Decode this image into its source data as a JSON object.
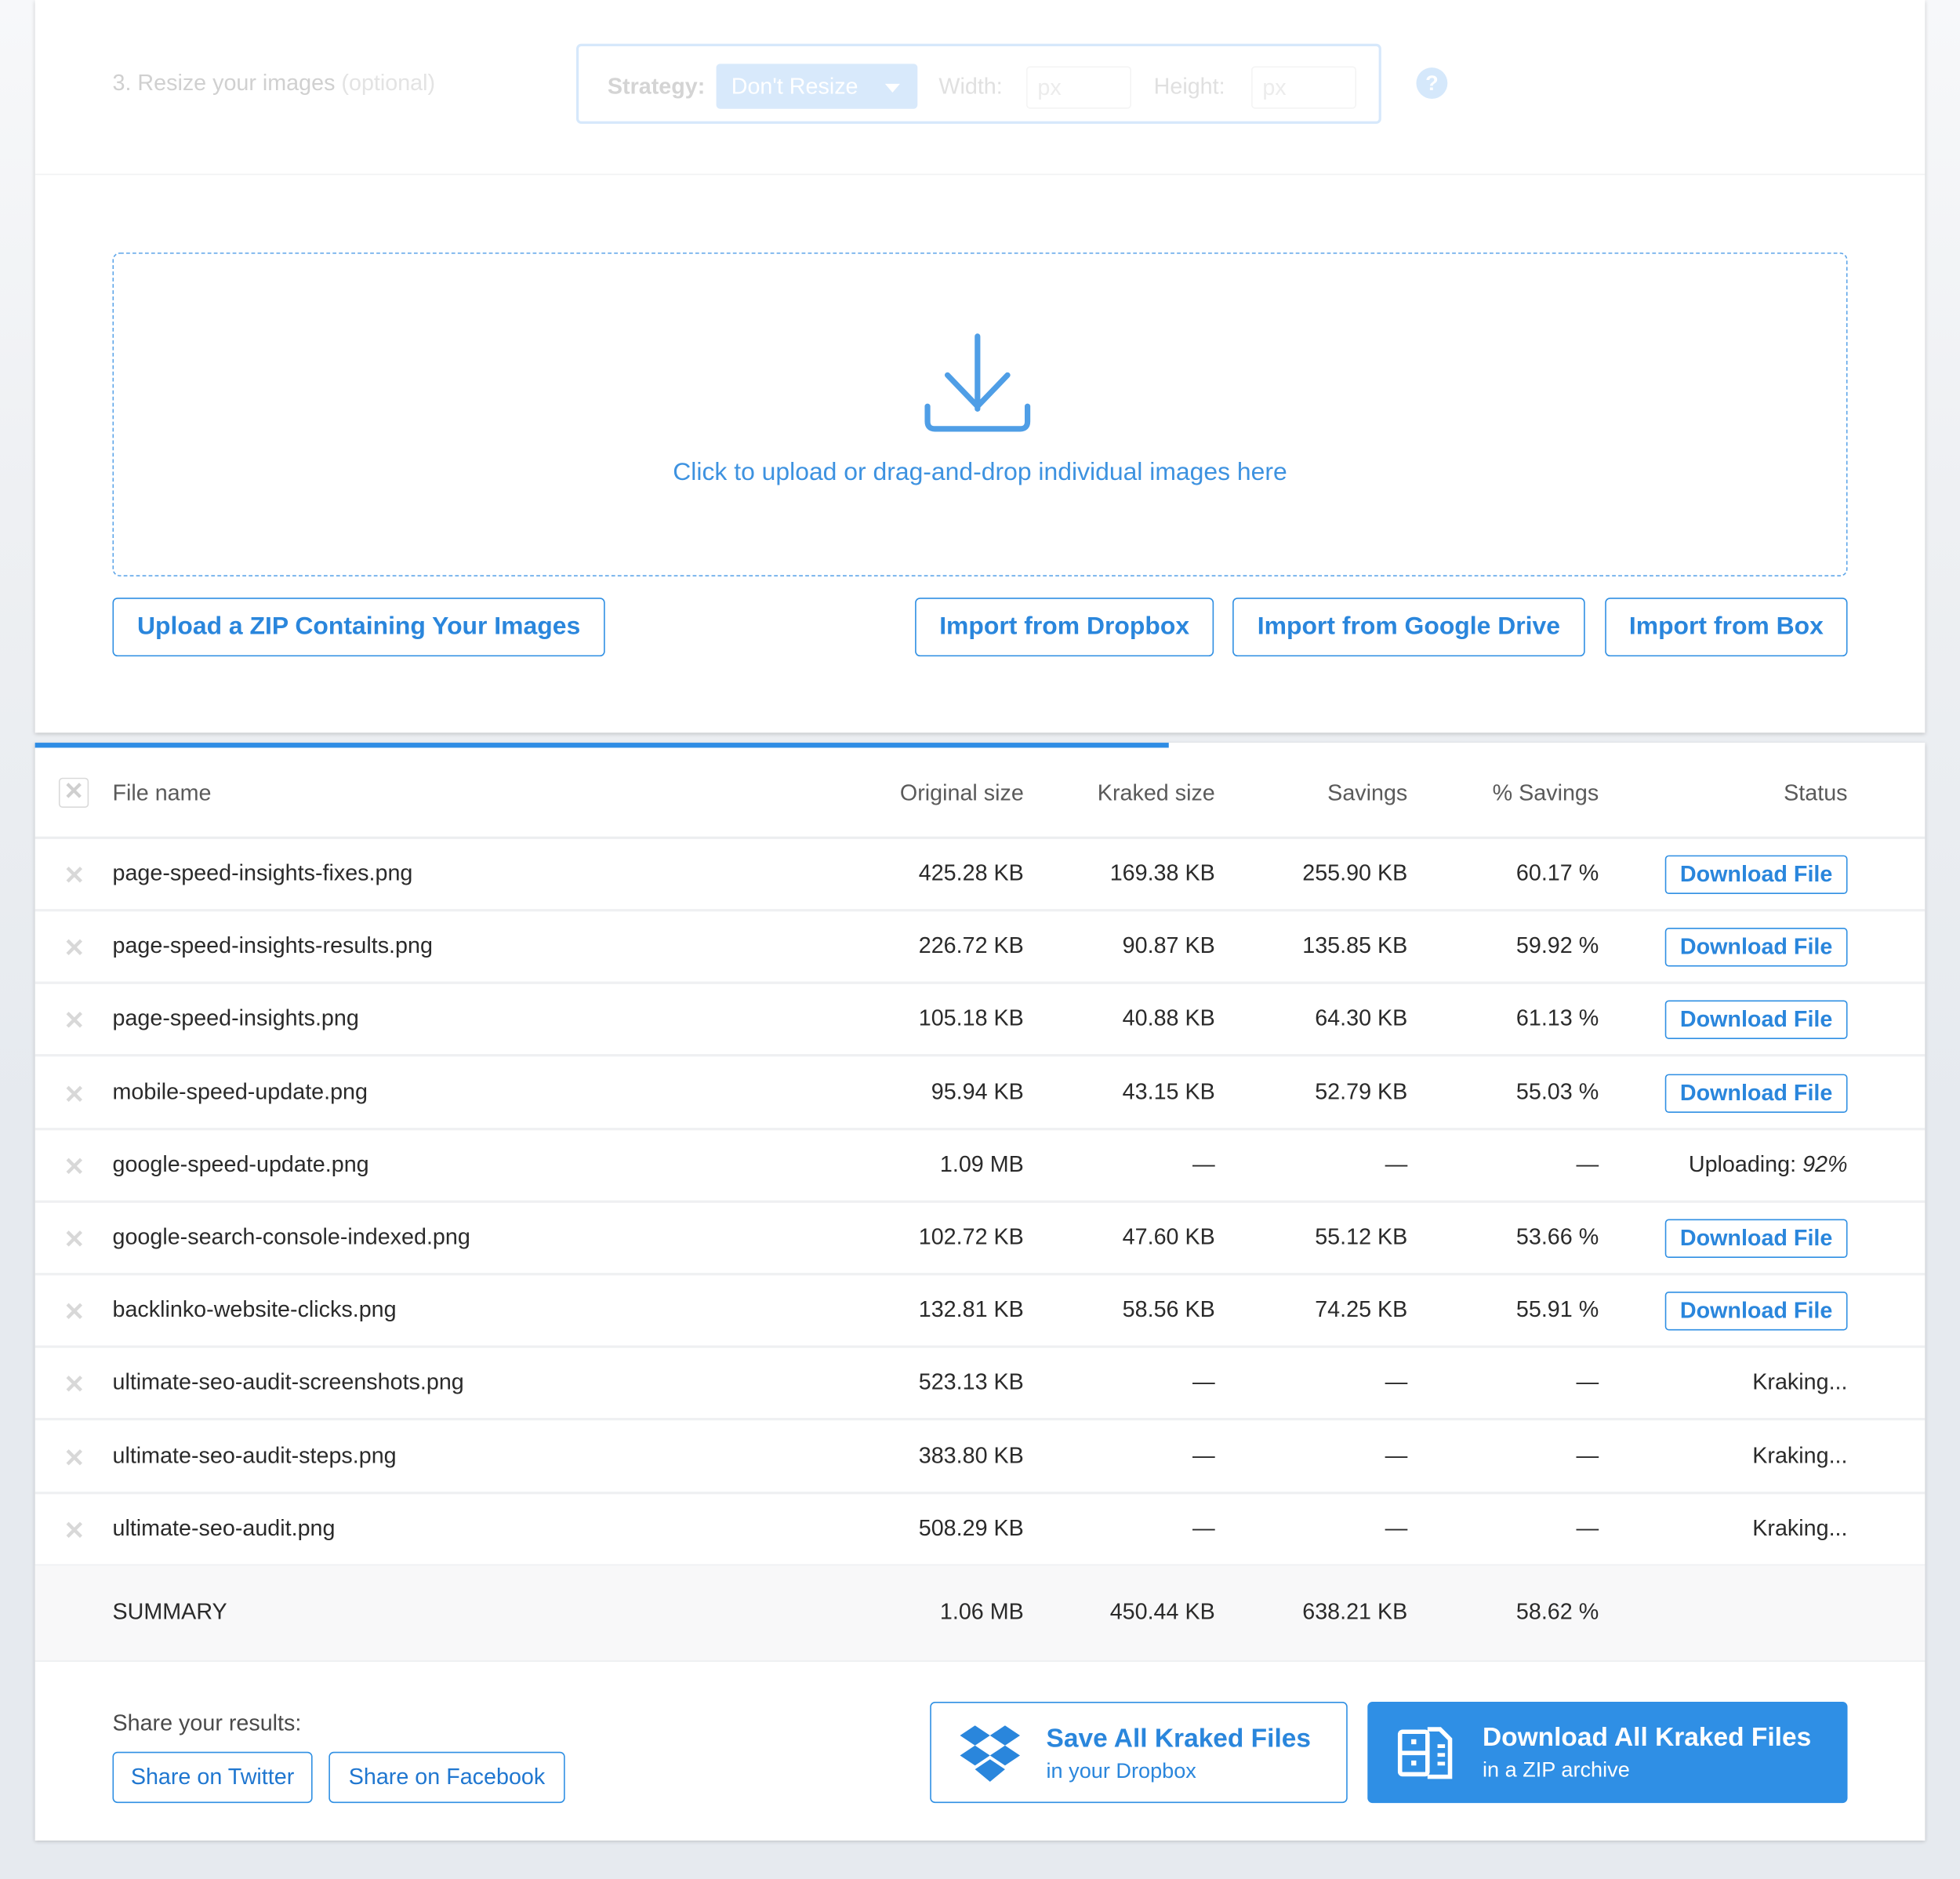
{
  "resize": {
    "step_label": "3. Resize your images",
    "optional_label": "(optional)",
    "strategy_label": "Strategy:",
    "strategy_value": "Don't Resize",
    "width_label": "Width:",
    "width_placeholder": "px",
    "height_label": "Height:",
    "height_placeholder": "px",
    "help_glyph": "?"
  },
  "dropzone": {
    "icon": "download-tray-icon",
    "text": "Click to upload or drag-and-drop individual images here"
  },
  "sources": {
    "upload_zip": "Upload a ZIP Containing Your Images",
    "dropbox": "Import from Dropbox",
    "google_drive": "Import from Google Drive",
    "box": "Import from Box"
  },
  "progress": {
    "overall_fraction": 0.6
  },
  "table": {
    "select_all_glyph": "✕",
    "remove_glyph": "✕",
    "headers": {
      "file_name": "File name",
      "original_size": "Original size",
      "kraked_size": "Kraked size",
      "savings": "Savings",
      "pct_savings": "% Savings",
      "status": "Status"
    },
    "rows": [
      {
        "name": "page-speed-insights-fixes.png",
        "original": "425.28 KB",
        "kraked": "169.38 KB",
        "savings": "255.90 KB",
        "pct": "60.17 %",
        "status": "Download File",
        "status_type": "button"
      },
      {
        "name": "page-speed-insights-results.png",
        "original": "226.72 KB",
        "kraked": "90.87 KB",
        "savings": "135.85 KB",
        "pct": "59.92 %",
        "status": "Download File",
        "status_type": "button"
      },
      {
        "name": "page-speed-insights.png",
        "original": "105.18 KB",
        "kraked": "40.88 KB",
        "savings": "64.30 KB",
        "pct": "61.13 %",
        "status": "Download File",
        "status_type": "button"
      },
      {
        "name": "mobile-speed-update.png",
        "original": "95.94 KB",
        "kraked": "43.15 KB",
        "savings": "52.79 KB",
        "pct": "55.03 %",
        "status": "Download File",
        "status_type": "button"
      },
      {
        "name": "google-speed-update.png",
        "original": "1.09 MB",
        "kraked": "—",
        "savings": "—",
        "pct": "—",
        "status": "Uploading:",
        "status_extra": "92%",
        "status_type": "uploading"
      },
      {
        "name": "google-search-console-indexed.png",
        "original": "102.72 KB",
        "kraked": "47.60 KB",
        "savings": "55.12 KB",
        "pct": "53.66 %",
        "status": "Download File",
        "status_type": "button"
      },
      {
        "name": "backlinko-website-clicks.png",
        "original": "132.81 KB",
        "kraked": "58.56 KB",
        "savings": "74.25 KB",
        "pct": "55.91 %",
        "status": "Download File",
        "status_type": "button"
      },
      {
        "name": "ultimate-seo-audit-screenshots.png",
        "original": "523.13 KB",
        "kraked": "—",
        "savings": "—",
        "pct": "—",
        "status": "Kraking...",
        "status_type": "text"
      },
      {
        "name": "ultimate-seo-audit-steps.png",
        "original": "383.80 KB",
        "kraked": "—",
        "savings": "—",
        "pct": "—",
        "status": "Kraking...",
        "status_type": "text"
      },
      {
        "name": "ultimate-seo-audit.png",
        "original": "508.29 KB",
        "kraked": "—",
        "savings": "—",
        "pct": "—",
        "status": "Kraking...",
        "status_type": "text"
      }
    ],
    "summary": {
      "label": "SUMMARY",
      "original": "1.06 MB",
      "kraked": "450.44 KB",
      "savings": "638.21 KB",
      "pct": "58.62 %"
    }
  },
  "share": {
    "label": "Share your results:",
    "twitter": "Share on Twitter",
    "facebook": "Share on Facebook"
  },
  "bulk": {
    "dropbox_title": "Save All Kraked Files",
    "dropbox_sub": "in your Dropbox",
    "zip_title": "Download All Kraked Files",
    "zip_sub": "in a ZIP archive"
  },
  "colors": {
    "accent": "#2f8fe5",
    "text": "#2a2a2a",
    "muted_header": "#5a5a5a",
    "page_bg": "#e6eaef"
  }
}
